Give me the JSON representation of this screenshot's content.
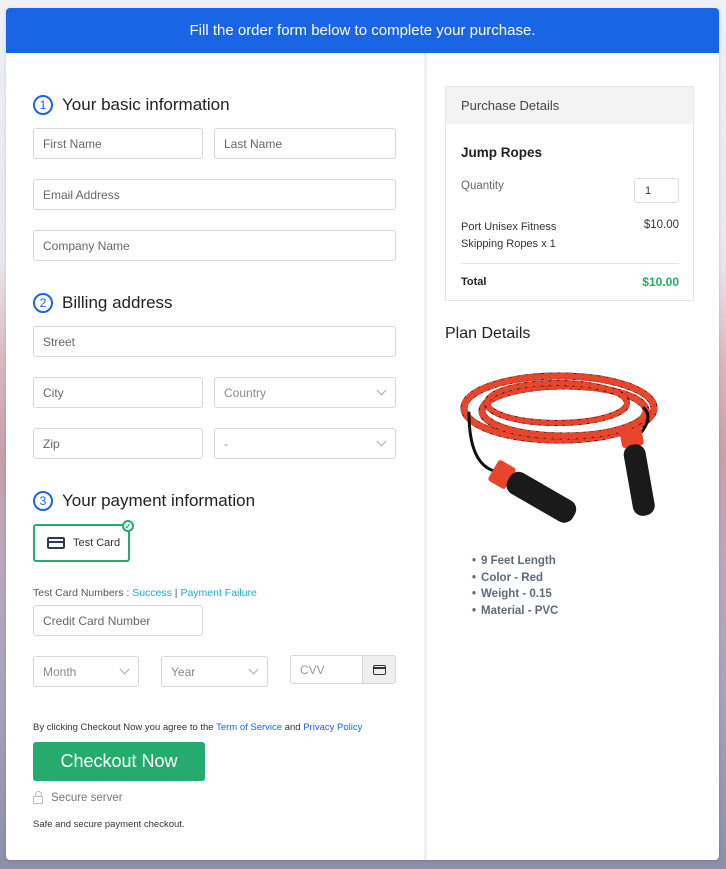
{
  "banner": {
    "text": "Fill the order form below to complete your purchase."
  },
  "sections": {
    "basic": {
      "number": "1",
      "title": "Your basic information"
    },
    "billing": {
      "number": "2",
      "title": "Billing address"
    },
    "payment": {
      "number": "3",
      "title": "Your payment information"
    }
  },
  "fields": {
    "first_name": {
      "placeholder": "First Name",
      "value": ""
    },
    "last_name": {
      "placeholder": "Last Name",
      "value": ""
    },
    "email": {
      "placeholder": "Email Address",
      "value": ""
    },
    "company": {
      "placeholder": "Company Name",
      "value": ""
    },
    "street": {
      "placeholder": "Street",
      "value": ""
    },
    "city": {
      "placeholder": "City",
      "value": ""
    },
    "country": {
      "selected": "Country"
    },
    "zip": {
      "placeholder": "Zip",
      "value": ""
    },
    "state": {
      "selected": "-"
    },
    "card_number": {
      "placeholder": "Credit Card Number",
      "value": ""
    },
    "month": {
      "selected": "Month"
    },
    "year": {
      "selected": "Year"
    },
    "cvv": {
      "placeholder": "CVV",
      "value": ""
    }
  },
  "payment": {
    "method_label": "Test Card",
    "method_icon": "credit-card-icon",
    "selected_icon": "check-circle-icon",
    "test_numbers_label": "Test Card Numbers : ",
    "success_link": "Success",
    "separator": " | ",
    "failure_link": "Payment Failure"
  },
  "agreement": {
    "prefix": "By clicking Checkout Now you agree to the ",
    "terms_link": "Term of Service",
    "and": " and ",
    "privacy_link": "Privacy Policy"
  },
  "checkout": {
    "label": "Checkout Now",
    "color": "#25ab6e"
  },
  "secure": {
    "label": "Secure server",
    "icon": "lock-icon",
    "note": "Safe and secure payment checkout."
  },
  "purchase_details": {
    "header": "Purchase Details",
    "product": "Jump Ropes",
    "quantity_label": "Quantity",
    "quantity": "1",
    "item_line": "Port Unisex Fitness Skipping Ropes x 1",
    "item_price": "$10.00",
    "total_label": "Total",
    "total": "$10.00"
  },
  "plan_details": {
    "title": "Plan Details",
    "image_alt": "Jump rope with black foam handles and red/black braided cord",
    "features": [
      "9 Feet Length",
      "Color - Red",
      "Weight - 0.15",
      "Material - PVC"
    ]
  },
  "colors": {
    "brand_blue": "#1a65e6",
    "success_green": "#25ab6e",
    "link_teal": "#1eaec1"
  }
}
